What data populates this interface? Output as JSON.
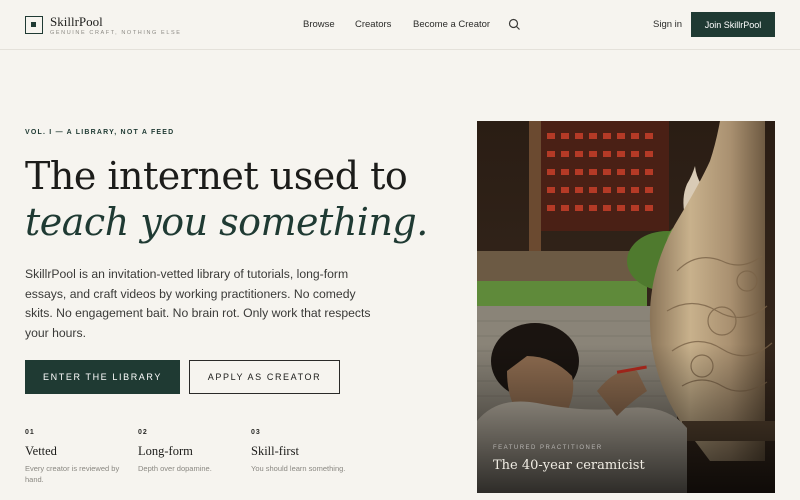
{
  "brand": {
    "name": "SkillrPool",
    "tagline": "GENUINE CRAFT, NOTHING ELSE"
  },
  "nav": {
    "links": [
      "Browse",
      "Creators",
      "Become a Creator"
    ],
    "search_icon": "search-icon",
    "signin": "Sign in",
    "join": "Join SkillrPool"
  },
  "hero": {
    "eyebrow": "VOL. I — A LIBRARY, NOT A FEED",
    "headline_1": "The internet used to",
    "headline_2": "teach you something.",
    "lede": "SkillrPool is an invitation-vetted library of tutorials, long-form essays, and craft videos by working practitioners. No comedy skits. No engagement bait. No brain rot. Only work that respects your hours.",
    "primary_cta": "ENTER THE LIBRARY",
    "secondary_cta": "APPLY AS CREATOR"
  },
  "features": [
    {
      "num": "01",
      "title": "Vetted",
      "desc": "Every creator is reviewed by hand."
    },
    {
      "num": "02",
      "title": "Long-form",
      "desc": "Depth over dopamine."
    },
    {
      "num": "03",
      "title": "Skill-first",
      "desc": "You should learn something."
    }
  ],
  "photo": {
    "label": "FEATURED PRACTITIONER",
    "caption": "The 40-year ceramicist"
  },
  "colors": {
    "accent": "#1f3a33",
    "background": "#f6f4ef"
  }
}
